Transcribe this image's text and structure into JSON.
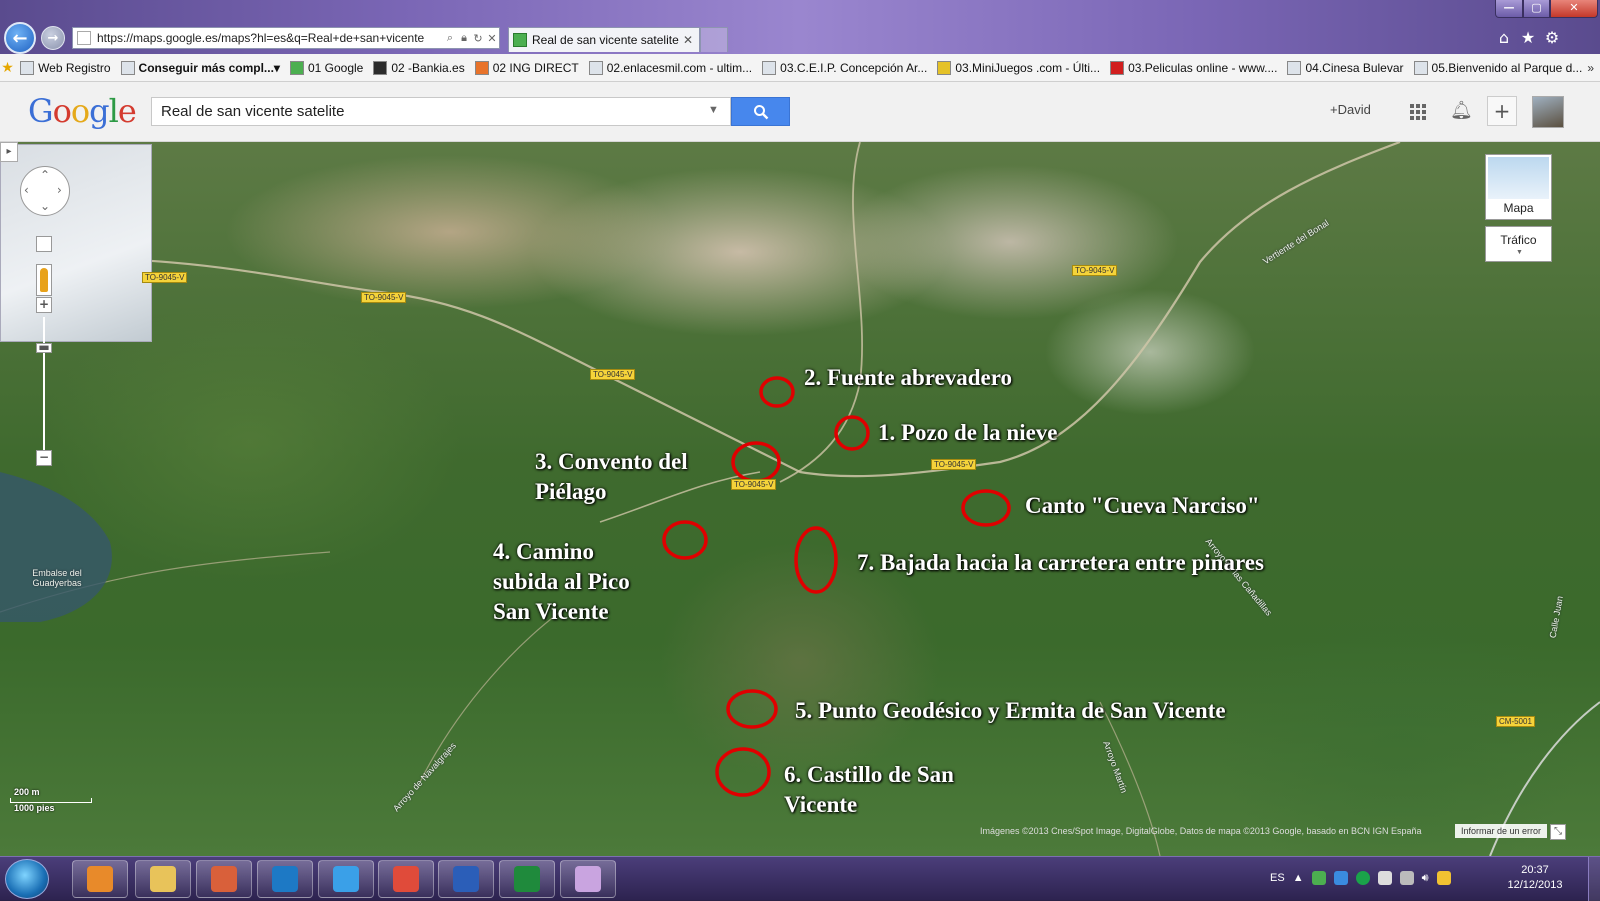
{
  "browser": {
    "url": "https://maps.google.es/maps?hl=es&q=Real+de+san+vicente",
    "tab_title": "Real de san vicente satelite ...",
    "tab_close": "✕",
    "window_controls": {
      "minimize": "—",
      "maximize": "▢",
      "close": "✕"
    }
  },
  "favorites": [
    {
      "label": "Web Registro",
      "bold": false,
      "icon_color": "#dde3ea"
    },
    {
      "label": "Conseguir más compl...",
      "bold": true,
      "icon_color": "#dde3ea"
    },
    {
      "label": "01 Google",
      "bold": false,
      "icon_color": "#4caf50"
    },
    {
      "label": "02 -Bankia.es",
      "bold": false,
      "icon_color": "#2b2b2b"
    },
    {
      "label": "02 ING DIRECT",
      "bold": false,
      "icon_color": "#e8732a"
    },
    {
      "label": "02.enlacesmil.com - ultim...",
      "bold": false,
      "icon_color": "#dde3ea"
    },
    {
      "label": "03.C.E.I.P. Concepción Ar...",
      "bold": false,
      "icon_color": "#dde3ea"
    },
    {
      "label": "03.MiniJuegos .com - Últi...",
      "bold": false,
      "icon_color": "#e5c228"
    },
    {
      "label": "03.Peliculas online - www....",
      "bold": false,
      "icon_color": "#d11f1f"
    },
    {
      "label": "04.Cinesa Bulevar",
      "bold": false,
      "icon_color": "#dde3ea"
    },
    {
      "label": "05.Bienvenido al Parque d...",
      "bold": false,
      "icon_color": "#dde3ea"
    }
  ],
  "google": {
    "logo": [
      "G",
      "o",
      "o",
      "g",
      "l",
      "e"
    ],
    "search_value": "Real de san vicente satelite",
    "user": "+David",
    "plus": "+"
  },
  "map": {
    "controls": {
      "minimap_toggle": "▸",
      "zoom_in": "+",
      "zoom_out": "−",
      "zoom_thumb": "▬"
    },
    "mapa_label": "Mapa",
    "trafico_label": "Tráfico",
    "road_tags": [
      "TO-9045-V",
      "TO-9045-V",
      "TO-9045-V",
      "TO-9045-V",
      "TO-9045-V",
      "TO-9045-V",
      "CM-5001"
    ],
    "place_labels": [
      "Embalse del Guadyerbas",
      "Vertiente del Bonal",
      "Arroyo de las Cañadillas",
      "Arroyo de Navalgrajes",
      "Arroyo Martín",
      "Calle Juan"
    ],
    "pois": [
      "2. Fuente abrevadero",
      "1. Pozo de la nieve",
      "3. Convento del Piélago",
      "Canto \"Cueva Narciso\"",
      "4. Camino subida al Pico San Vicente",
      "7. Bajada hacia la carretera entre pinares",
      "5. Punto Geodésico y Ermita de San Vicente",
      "6. Castillo de San Vicente"
    ],
    "scale_top": "200 m",
    "scale_bottom": "1000 pies",
    "attribution": "Imágenes ©2013 Cnes/Spot Image, DigitalGlobe, Datos de mapa ©2013 Google, basado en BCN IGN España",
    "report": "Informar de un error",
    "marker_color": "#e00000"
  },
  "taskbar": {
    "language": "ES",
    "time": "20:37",
    "date": "12/12/2013",
    "apps": [
      {
        "name": "media-player-icon",
        "color": "#e88a2a"
      },
      {
        "name": "folder-icon",
        "color": "#e8c35a"
      },
      {
        "name": "monitor-app-icon",
        "color": "#d9603a"
      },
      {
        "name": "hp-icon",
        "color": "#1d79c5"
      },
      {
        "name": "internet-explorer-icon",
        "color": "#3aa0e8"
      },
      {
        "name": "chrome-icon",
        "color": "#e04b3a"
      },
      {
        "name": "word-icon",
        "color": "#2b5eb8"
      },
      {
        "name": "excel-icon",
        "color": "#1f8a3c"
      },
      {
        "name": "paint-icon",
        "color": "#c9a4e0"
      }
    ]
  }
}
